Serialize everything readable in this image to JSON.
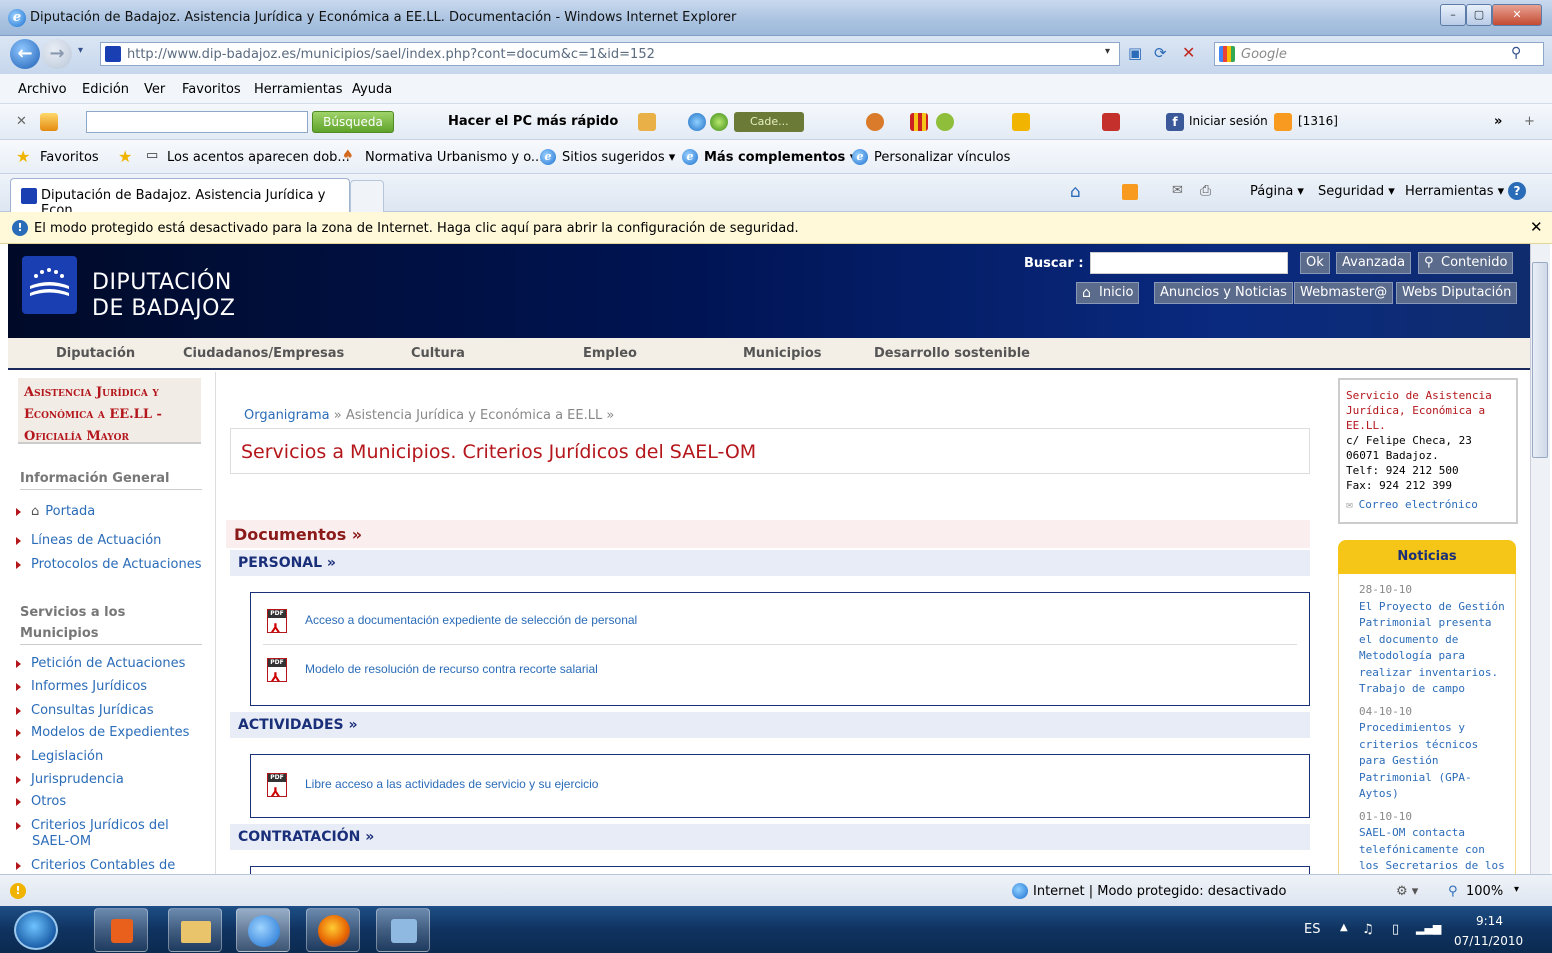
{
  "window": {
    "title": "Diputación de Badajoz. Asistencia Jurídica y Económica a EE.LL. Documentación - Windows Internet Explorer",
    "min_label": "–",
    "max_label": "▢",
    "close_label": "✕"
  },
  "address": {
    "url": "http://www.dip-badajoz.es/municipios/sael/index.php?cont=docum&c=1&id=152",
    "search_placeholder": "Google"
  },
  "menu": [
    "Archivo",
    "Edición",
    "Ver",
    "Favoritos",
    "Herramientas",
    "Ayuda"
  ],
  "toolbar": {
    "busqueda_label": "Búsqueda",
    "hacer_label": "Hacer el PC más rápido",
    "cade_label": "Cade...",
    "iniciar_label": "Iniciar sesión",
    "count_label": "[1316]"
  },
  "favorites": {
    "fav_label": "Favoritos",
    "items": [
      "Los acentos aparecen dob...",
      "Normativa Urbanismo y o...",
      "Sitios sugeridos ▾",
      "Más complementos ▾",
      "Personalizar vínculos"
    ]
  },
  "tab": {
    "title": "Diputación de Badajoz. Asistencia Jurídica y Econ...",
    "commands": [
      "Página ▾",
      "Seguridad ▾",
      "Herramientas ▾"
    ]
  },
  "infobar": {
    "text": "El modo protegido está desactivado para la zona de Internet. Haga clic aquí para abrir la configuración de seguridad."
  },
  "header": {
    "brand_line1": "DIPUTACIÓN",
    "brand_line2": "DE BADAJOZ",
    "buscar_label": "Buscar :",
    "ok_label": "Ok",
    "avanzada_label": "Avanzada",
    "contenido_label": "Contenido",
    "links": [
      "Inicio",
      "Anuncios y Noticias",
      "Webmaster@",
      "Webs Diputación"
    ]
  },
  "mainnav": [
    "Diputación",
    "Ciudadanos/Empresas",
    "Cultura",
    "Empleo",
    "Municipios",
    "Desarrollo sostenible"
  ],
  "sidebar": {
    "head_lines": [
      "Asistencia Jurídica y",
      "Económica a EE.LL -",
      "Oficialía Mayor"
    ],
    "section1": "Información General",
    "items1": [
      "Portada",
      "Líneas de Actuación",
      "Protocolos de Actuaciones"
    ],
    "section2_line1": "Servicios a los",
    "section2_line2": "Municipios",
    "items2": [
      "Petición de Actuaciones",
      "Informes Jurídicos",
      "Consultas Jurídicas",
      "Modelos de Expedientes",
      "Legislación",
      "Jurisprudencia",
      "Otros",
      "Criterios Jurídicos del",
      "SAEL-OM",
      "Criterios Contables de"
    ]
  },
  "content": {
    "crumb_link": "Organigrama",
    "crumb_rest": " » Asistencia Jurídica y Económica a EE.LL »",
    "title": "Servicios a Municipios. Criterios Jurídicos del SAEL-OM",
    "docs_header": "Documentos »",
    "sections": [
      {
        "title": "PERSONAL »",
        "docs": [
          "Acceso a documentación expediente de selección de personal",
          "Modelo de resolución de recurso contra recorte salarial"
        ]
      },
      {
        "title": "ACTIVIDADES »",
        "docs": [
          "Libre acceso a las actividades de servicio y su ejercicio"
        ]
      },
      {
        "title": "CONTRATACIÓN »",
        "docs": []
      }
    ],
    "pdf_label": "PDF"
  },
  "contact": {
    "lines_red": [
      "Servicio de Asistencia",
      "Jurídica, Económica a",
      "EE.LL."
    ],
    "lines": [
      "c/ Felipe Checa, 23",
      "06071 Badajoz.",
      "Telf: 924 212 500",
      "Fax: 924 212 399"
    ],
    "email_label": "Correo electrónico"
  },
  "news": {
    "header": "Noticias",
    "items": [
      {
        "date": "28-10-10",
        "text": "El Proyecto de Gestión Patrimonial presenta el documento de Metodología para realizar inventarios. Trabajo de campo"
      },
      {
        "date": "04-10-10",
        "text": "Procedimientos y criterios técnicos para Gestión Patrimonial (GPA-Aytos)"
      },
      {
        "date": "01-10-10",
        "text": "SAEL-OM contacta telefónicamente con los Secretarios de los"
      }
    ]
  },
  "status": {
    "zone_text": "Internet | Modo protegido: desactivado",
    "zoom": "100%"
  },
  "taskbar": {
    "lang": "ES",
    "time": "9:14",
    "date": "07/11/2010"
  }
}
